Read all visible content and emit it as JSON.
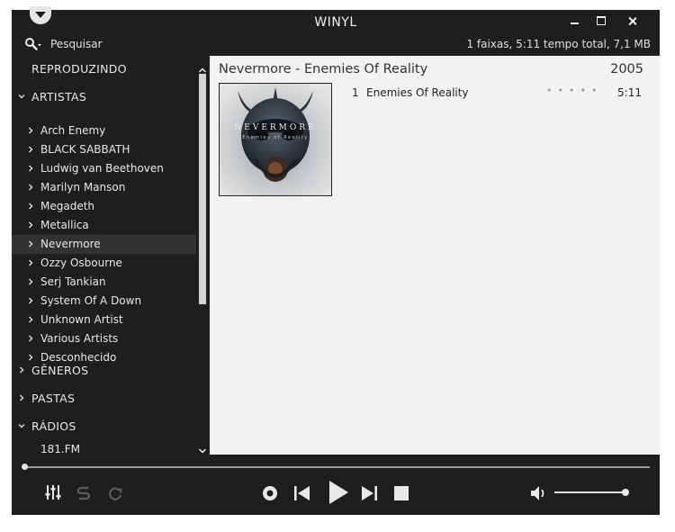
{
  "window": {
    "title": "WINYL",
    "search_label": "Pesquisar",
    "summary": "1 faixas, 5:11 tempo total, 7,1 MB"
  },
  "sidebar": {
    "now_playing": "REPRODUZINDO",
    "artists_header": "ARTISTAS",
    "artists": [
      "Arch Enemy",
      "BLACK SABBATH",
      "Ludwig van Beethoven",
      "Marilyn Manson",
      "Megadeth",
      "Metallica",
      "Nevermore",
      "Ozzy Osbourne",
      "Serj Tankian",
      "System Of A Down",
      "Unknown Artist",
      "Various Artists",
      "Desconhecido"
    ],
    "selected_artist": "Nevermore",
    "genres_header": "GÊNEROS",
    "folders_header": "PASTAS",
    "radios_header": "RÁDIOS",
    "radios": [
      "181.FM"
    ]
  },
  "album": {
    "title": "Nevermore - Enemies Of Reality",
    "year": "2005",
    "cover_band": "NEVERMORE",
    "cover_album": "Enemies of Reality",
    "tracks": [
      {
        "number": "1",
        "title": "Enemies Of Reality",
        "rating_dots": "•••••",
        "length": "5:11"
      }
    ]
  },
  "player": {
    "position_fraction": 0.0,
    "volume_fraction": 0.95
  },
  "colors": {
    "window_bg": "#1e1e1e",
    "content_bg": "#f2f2f2",
    "selected_row": "#323232",
    "text_light": "#e8e8e8"
  }
}
